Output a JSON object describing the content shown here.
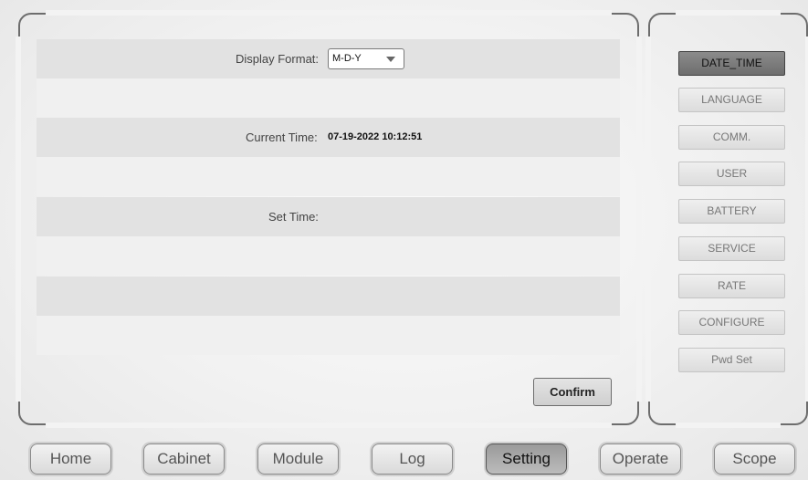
{
  "date_time_panel": {
    "display_format_label": "Display Format:",
    "display_format_value": "M-D-Y",
    "current_time_label": "Current Time:",
    "current_time_value": "07-19-2022 10:12:51",
    "set_time_label": "Set Time:",
    "confirm_label": "Confirm"
  },
  "side_menu": {
    "items": [
      {
        "label": "DATE_TIME",
        "active": true
      },
      {
        "label": "LANGUAGE",
        "active": false
      },
      {
        "label": "COMM.",
        "active": false
      },
      {
        "label": "USER",
        "active": false
      },
      {
        "label": "BATTERY",
        "active": false
      },
      {
        "label": "SERVICE",
        "active": false
      },
      {
        "label": "RATE",
        "active": false
      },
      {
        "label": "CONFIGURE",
        "active": false
      },
      {
        "label": "Pwd Set",
        "active": false
      }
    ]
  },
  "bottom_nav": {
    "items": [
      {
        "label": "Home",
        "active": false
      },
      {
        "label": "Cabinet",
        "active": false
      },
      {
        "label": "Module",
        "active": false
      },
      {
        "label": "Log",
        "active": false
      },
      {
        "label": "Setting",
        "active": true
      },
      {
        "label": "Operate",
        "active": false
      },
      {
        "label": "Scope",
        "active": false
      }
    ]
  }
}
